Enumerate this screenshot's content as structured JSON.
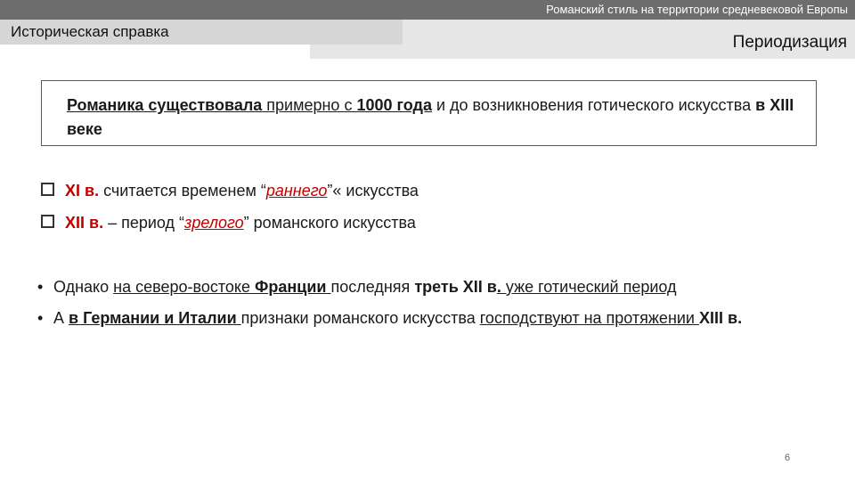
{
  "header": {
    "course_title": "Романский стиль на территории средневековой Европы",
    "section_label": "Историческая справка",
    "slide_subtitle": "Периодизация"
  },
  "quote": {
    "p1": "Романика существовала",
    "p2": " примерно с ",
    "p3": "1000 года",
    "p4": " и до возникновения готического искусства ",
    "p5": "в XIII веке"
  },
  "q_items": [
    {
      "a": "XI в.",
      "b": " считается временем “",
      "c": "раннего",
      "d": "”« искусства"
    },
    {
      "a": "XII в.",
      "b": " – период “",
      "c": "зрелого",
      "d": "” романского искусства"
    }
  ],
  "bullets": [
    {
      "a": "Однако ",
      "b": "на северо-востоке ",
      "c": "Франции ",
      "d": "последняя ",
      "e": "треть XII в",
      "f": ".",
      "g": " уже готический период"
    },
    {
      "a": "А ",
      "b": "в Германии и Италии ",
      "c": "признаки романского искусства  ",
      "d": "господствуют на протяжении ",
      "e": "XIII в."
    }
  ],
  "bullet_glyph": "•",
  "page_number": "6",
  "colors": {
    "accent_red": "#c00000",
    "top_bar": "#6d6d6d",
    "section_bar": "#d6d6d6",
    "subtitle_bar": "#e6e6e6"
  }
}
